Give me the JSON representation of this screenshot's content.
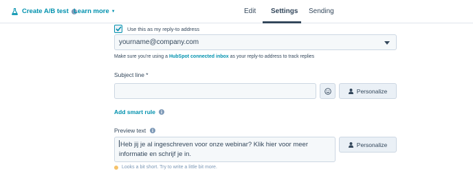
{
  "header": {
    "ab_test_label": "Create A/B test",
    "learn_more_label": "Learn more",
    "tabs": [
      {
        "label": "Edit"
      },
      {
        "label": "Settings",
        "active": true
      },
      {
        "label": "Sending"
      }
    ]
  },
  "reply_to": {
    "checkbox_label": "Use this as my reply-to address",
    "checked": true,
    "selected_value": "yourname@company.com",
    "help_prefix": "Make sure you're using a ",
    "help_link": "HubSpot connected inbox",
    "help_suffix": " as your reply-to address to track replies"
  },
  "subject": {
    "label": "Subject line *",
    "value": "",
    "personalize_label": "Personalize"
  },
  "smart_rule": {
    "label": "Add smart rule"
  },
  "preview": {
    "label": "Preview text",
    "value": "Heb jij je al ingeschreven voor onze webinar? Klik hier voor meer informatie en schrijf je in.",
    "personalize_label": "Personalize",
    "warning": "Looks a bit short. Try to write a little bit more."
  },
  "colors": {
    "link": "#0091ae",
    "text": "#33475b",
    "border": "#cbd6e2",
    "warning_dot": "#f5c26b"
  },
  "icons": [
    "flask-icon",
    "info-icon",
    "chevron-down-icon",
    "checkmark-icon",
    "emoji-icon",
    "person-icon"
  ]
}
